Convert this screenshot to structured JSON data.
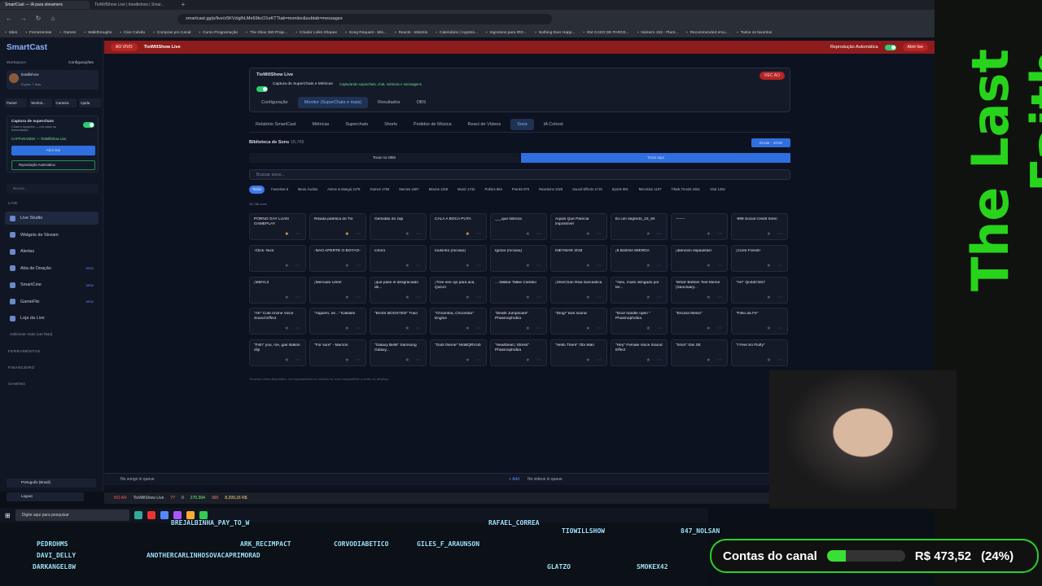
{
  "browser": {
    "tabs": [
      "SmartCast — IA para streamers",
      "TioWillShow Live | tiowillshow | Smar..."
    ],
    "url": "smartcast.gg/p/live/z5KVzlglhLMe69kcO1eKTTtab=monitor&subtab=messages",
    "bookmarks": [
      "Sites",
      "Ferramentas",
      "Games",
      "Walkthroughs",
      "Cine Calvão",
      "Compras pro Canal",
      "Curso Programação",
      "The Xbox 360 Proje...",
      "Criador Links Shopee",
      "Song Request - Mis...",
      "Reacts - MissXis",
      "Calendário | Ingress...",
      "Ingressos para IRO...",
      "Nothing Ever Happ...",
      "EM CASO DE PARCE...",
      "Número 153 - Plant...",
      "Recommended emu...",
      "Todos os favoritos"
    ]
  },
  "sidebar": {
    "logo": "SmartCast",
    "workspace": "Workspace",
    "config": "Configurações",
    "user": "tiowillshow",
    "plan": "Expira: 7 dias",
    "nav_top": [
      "Painel",
      "Workst...",
      "Carteira",
      "Ajuda"
    ],
    "capture": {
      "title": "Captura de superchats",
      "desc": "Chats e doações — nós ativa na transmissão",
      "status": "CAPTURANDO — TioWillShow Live",
      "open_btn": "Abrir live",
      "auto": "Reprodução Automática"
    },
    "search_placeholder": "Buscar...",
    "section_live": "LIVE",
    "items": [
      {
        "label": "Live Studio",
        "new": ""
      },
      {
        "label": "Widgets de Stream",
        "new": ""
      },
      {
        "label": "Alertas",
        "new": ""
      },
      {
        "label": "Aba de Doação",
        "new": "NEW"
      },
      {
        "label": "SmartCine",
        "new": "NEW"
      },
      {
        "label": "GameFlix",
        "new": "NEW"
      },
      {
        "label": "Loja da Live",
        "new": ""
      }
    ],
    "add_more": "Adicionar mais (ver lista)",
    "sections": [
      "FERRAMENTAS",
      "FINANCEIRO",
      "GAMING"
    ],
    "language": "Português (Brasil)",
    "logout": "Logout"
  },
  "topbar": {
    "live_badge": "AO VIVO",
    "title": "TioWillShow Live",
    "auto_play": "Reprodução Automática",
    "open_live": "Abrir live"
  },
  "live_card": {
    "title": "TioWillShow Live",
    "capture": "Captura de SuperChats e Métricas",
    "capture_status": "Capturando superchats, chat, métricas e mensagens",
    "rec": "REC AO",
    "tabs": [
      "Configuração",
      "Monitor (SuperChats e mais)",
      "Resultados"
    ],
    "obs": "OBS"
  },
  "monitor_tabs": [
    "Relatório SmartCast",
    "Métricas",
    "Superchats",
    "Shorts",
    "Pedidos de Música",
    "React de Vídeos",
    "Sons",
    "IA Cohost"
  ],
  "library": {
    "title": "Biblioteca de Sons",
    "count": "18,766",
    "send_btn": "Enviar · 4/100",
    "play_obs": "Tocar no OBS",
    "play_here": "Tocar aqui",
    "search_placeholder": "Buscar sons...",
    "total": "18,766 sons",
    "footer": "Tocando neste dispositivo. Os espectadores só ouvirão se você compartilhar o áudio do desktop."
  },
  "categories": [
    "Todos",
    "Favoritos 6",
    "Meus Áudios",
    "Anime & Mangá 1376",
    "Games 1783",
    "Memes 1687",
    "Movies 1159",
    "Music 1742",
    "Politics 864",
    "Pranks 970",
    "Reactions 1026",
    "Sound Effects 1715",
    "Sports 991",
    "Television 1197",
    "Tiktok Trends 1051",
    "Viral 1254"
  ],
  "sounds": [
    [
      "PORNÔ GAY LUAN GAMEPLAY",
      "Risada patética do Tio",
      "Gemidão do zap",
      "CALA A BOCA PUTA",
      "___que tistreza",
      "Aquilo Que Parecia impossível",
      "Eu um segredo_23_84",
      "-------",
      "-999 Social Credit Siren"
    ],
    [
      "-Click- Nice",
      "-NÃO APERTE O BOTÃO-",
      "Ichoro",
      "Iousinho (mcvaio)",
      "Igozar (mcvaio)",
      "INEYMAR 2CM",
      "¡8 BUENA MIERDA",
      "¡atención espaulitas!",
      "¡Corre Forest!"
    ],
    [
      "¡MMYL3",
      "¡Mercado Libre!",
      "¡que pase el desgraciado de...",
      "¡Tree eee ojo para acá, Quico!",
      "....Walkie Talkie Cambio",
      "¡ShinChan Risa Sarcastica",
      "\"Alex, muito obrigado por ter...",
      "'What' Bottom Text Meme (Sanctuary...",
      "\"AH\" Qn4dCNS7"
    ],
    [
      "\"Ah\" Cute Anime Voice Sound Effect",
      "\"Alguém, né...\" Kakashi",
      "\"BASS BOOSTED\" Train",
      "\"Choomba, Choomba\" Engine",
      "\"Death Jumpscare\" Phasmophobia",
      "\"Ding!\" kiss sound",
      "\"Door handle open \" Phasmophobia",
      "\"Encara Messi\"",
      "\"Filho da Fé\""
    ],
    [
      "\"Fish\" you, me, gas station clip",
      "\"For sure\" - Macron",
      "\"Galaxy Bells\" Samsung Galaxy...",
      "\"Guts theme\" NmBQRVUb",
      "\"Heartbeat | Stress\" Phasmophobia",
      "\"Hello There\" Obi Wan",
      "\"Hey\" Female Voice Sound Effect",
      "\"hmm\" rblx SE",
      "\"I Feel So Fluffy\""
    ]
  ],
  "starred": [
    [
      1,
      1,
      0,
      1,
      0,
      0,
      0,
      0,
      0
    ],
    [
      0,
      0,
      0,
      0,
      0,
      0,
      0,
      0,
      0
    ],
    [
      0,
      0,
      0,
      0,
      0,
      0,
      0,
      0,
      0
    ],
    [
      0,
      0,
      0,
      0,
      0,
      0,
      0,
      0,
      0
    ],
    [
      0,
      0,
      0,
      0,
      0,
      0,
      0,
      0,
      0
    ]
  ],
  "bottombar": {
    "songs": "No songs in queue",
    "add": "+ Add",
    "videos": "No videos in queue"
  },
  "obs_strip": {
    "live": "NO AR",
    "title": "TioWillShow Live",
    "stats": [
      "77",
      "0",
      "270.394",
      "300",
      "8.299,16 R$"
    ]
  },
  "taskbar": {
    "search": "Digite aqui para pesquisar"
  },
  "overlay_names": [
    "PEDROHMS",
    "DAVI_DELLY",
    "DARKANGEL8W",
    "ANOTHERCARLINHOSOVACAPRIMORAD",
    "ARK_RECIMPACT",
    "BREJALBINHA_PAY_TO_W",
    "CORVODIABETICO",
    "GILES_F_ARAUNSON",
    "RAFAEL_CORREA",
    "TIOWILLSHOW",
    "847_NOLSAN",
    "SMOKEX42",
    "GLATZO"
  ],
  "stream": {
    "side_text": "The Last Faith",
    "goal_label": "Contas do canal",
    "goal_value": "R$ 473,52",
    "goal_pct": "(24%)",
    "goal_fraction": 0.24
  }
}
